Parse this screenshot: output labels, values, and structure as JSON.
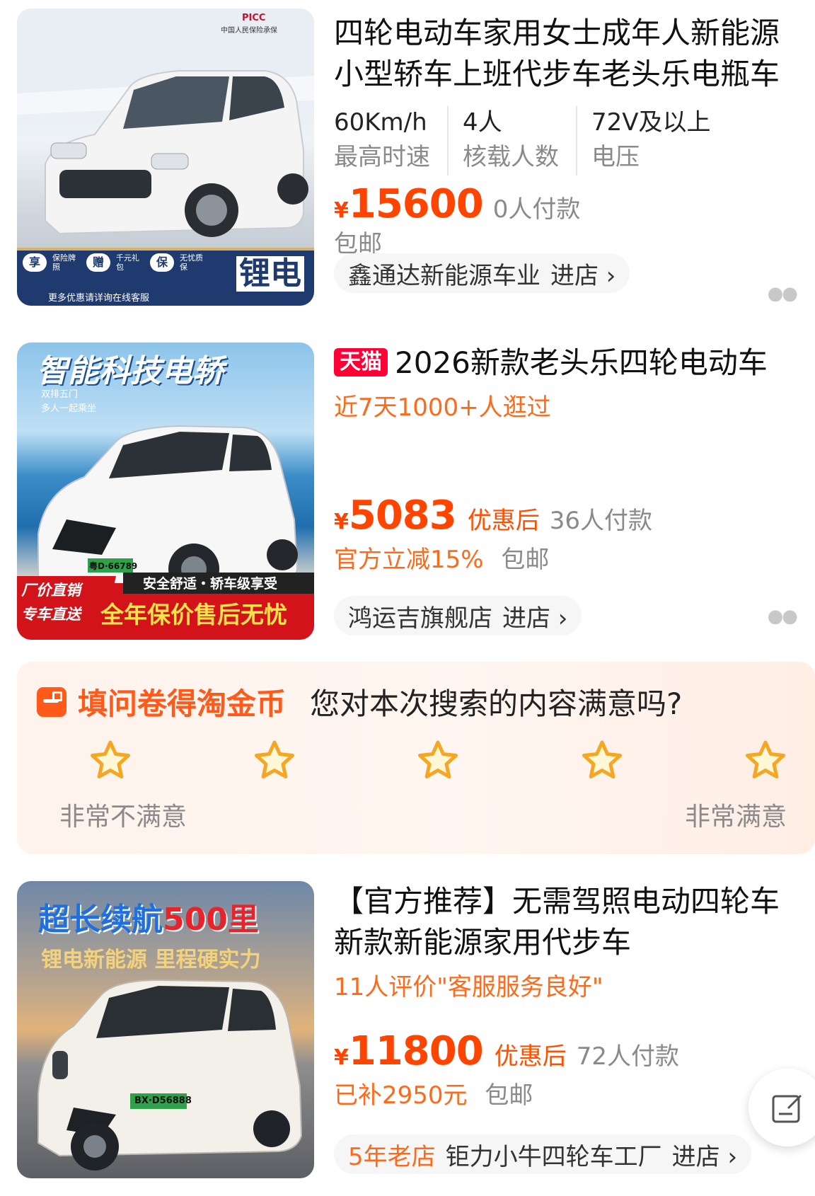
{
  "items": [
    {
      "title": "四轮电动车家用女士成年人新能源小型轿车上班代步车老头乐电瓶车",
      "title_lines": [
        "四轮电动车家用女士成年人新能源",
        "小型轿车上班代步车老头乐电瓶车"
      ],
      "specs": [
        {
          "value": "60Km/h",
          "label": "最高时速"
        },
        {
          "value": "4人",
          "label": "核载人数"
        },
        {
          "value": "72V及以上",
          "label": "电压"
        }
      ],
      "yen": "¥",
      "price": "15600",
      "paid": "0人付款",
      "shipping": "包邮",
      "shop": "鑫通达新能源车业",
      "enter": "进店 ›",
      "image": {
        "brand": "PICC",
        "brand_sub": "中国人民保险承保",
        "badges": [
          "保险牌照",
          "千元礼包",
          "无忧质保"
        ],
        "badge_chars": [
          "享",
          "赠",
          "保"
        ],
        "footer": "更多优惠请详询在线客服",
        "side": "锂电"
      }
    },
    {
      "badge": "天猫",
      "title": "2026新款老头乐四轮电动车",
      "visits": "近7天1000+人逛过",
      "yen": "¥",
      "price": "5083",
      "after": "优惠后",
      "paid": "36人付款",
      "discount": "官方立减15%",
      "shipping": "包邮",
      "shop": "鸿运吉旗舰店",
      "enter": "进店 ›",
      "image": {
        "headline": "智能科技电轿",
        "sub1": "双排五门",
        "sub2": "多人一起乘坐",
        "comfort": "安全舒适・轿车级享受",
        "corner1": "厂价直销",
        "corner2": "专车直送",
        "banner": "全年保价售后无忧",
        "plate": "粤D·66789"
      }
    },
    {
      "title_lines": [
        "【官方推荐】无需驾照电动四轮车",
        "新款新能源家用代步车"
      ],
      "review": "11人评价\"客服服务良好\"",
      "yen": "¥",
      "price": "11800",
      "after": "优惠后",
      "paid": "72人付款",
      "subsidy": "已补2950元",
      "shipping": "包邮",
      "shop_age": "5年老店",
      "shop": "钜力小牛四轮车工厂",
      "enter": "进店 ›",
      "image": {
        "headline_a": "超长续航",
        "headline_b": "500里",
        "sub": "锂电新能源 里程硬实力",
        "plate": "BX·D56888"
      }
    }
  ],
  "survey": {
    "reward": "填问卷得淘金币",
    "question": "您对本次搜索的内容满意吗?",
    "left_label": "非常不满意",
    "right_label": "非常满意",
    "star_count": 5
  },
  "colors": {
    "price": "#ff4400",
    "accent": "#ff5a1a",
    "star": "#f5a623",
    "tmall": "#ff0036"
  }
}
